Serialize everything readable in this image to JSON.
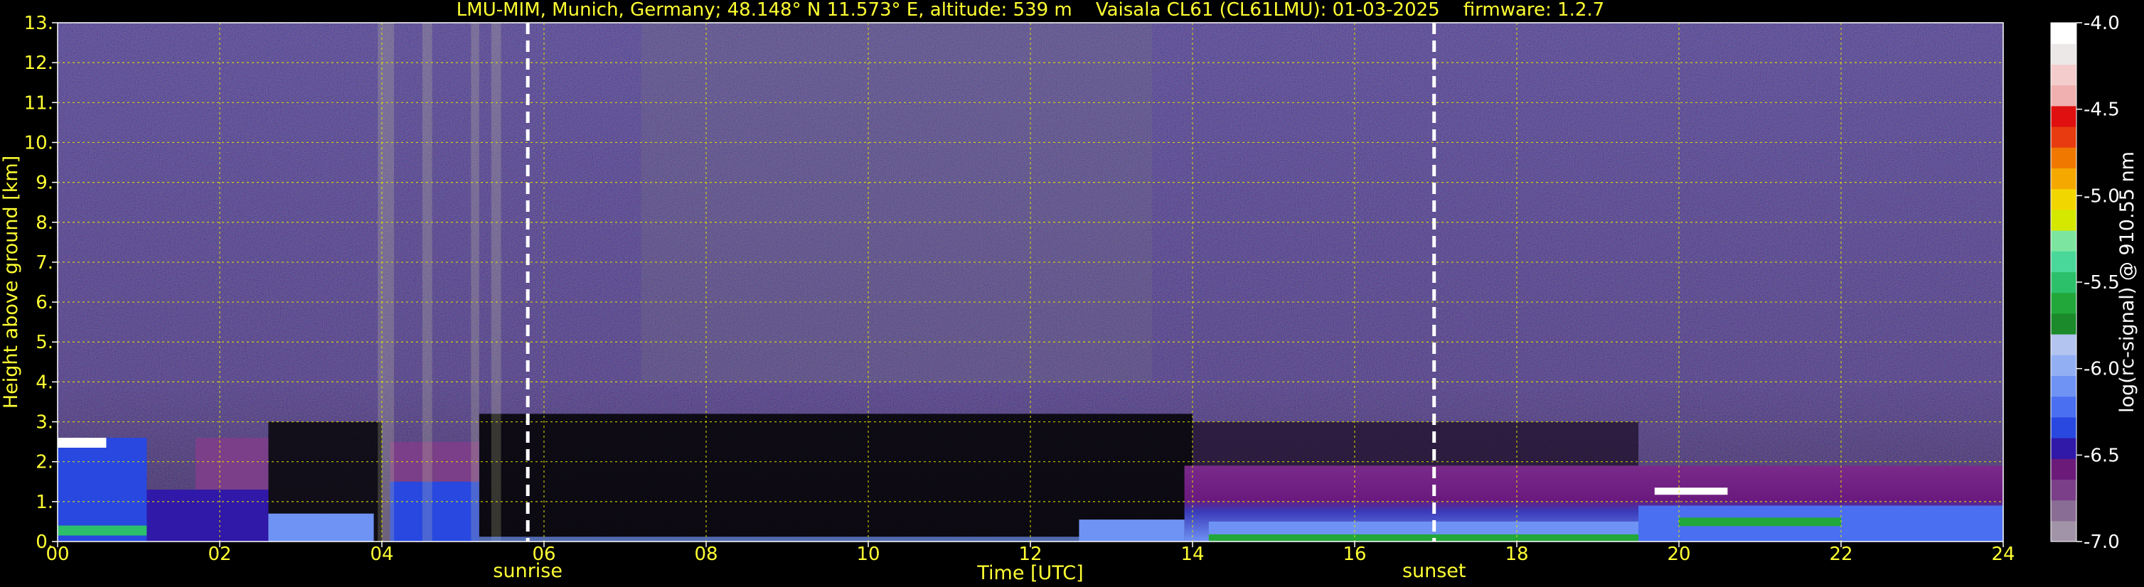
{
  "chart_data": {
    "type": "heatmap",
    "title": "LMU-MIM, Munich, Germany; 48.148° N 11.573° E, altitude: 539 m    Vaisala CL61 (CL61LMU): 01-03-2025    firmware: 1.2.7",
    "xlabel": "Time [UTC]",
    "ylabel": "Height above ground [km]",
    "colorbar_label": "log(rc-signal) @ 910.55 nm",
    "xlim": [
      0,
      24
    ],
    "ylim": [
      0,
      13
    ],
    "x_ticks": [
      0,
      2,
      4,
      6,
      8,
      10,
      12,
      14,
      16,
      18,
      20,
      22,
      24
    ],
    "x_tick_labels": [
      "00",
      "02",
      "04",
      "06",
      "08",
      "10",
      "12",
      "14",
      "16",
      "18",
      "20",
      "22",
      "24"
    ],
    "y_ticks": [
      0,
      1,
      2,
      3,
      4,
      5,
      6,
      7,
      8,
      9,
      10,
      11,
      12,
      13
    ],
    "y_tick_labels": [
      "0.",
      "1.",
      "2.",
      "3.",
      "4.",
      "5.",
      "6.",
      "7.",
      "8.",
      "9.",
      "10.",
      "11.",
      "12.",
      "13."
    ],
    "grid": true,
    "colorbar": {
      "range": [
        -7.0,
        -4.0
      ],
      "ticks": [
        -7.0,
        -6.5,
        -6.0,
        -5.5,
        -5.0,
        -4.5,
        -4.0
      ],
      "tick_labels": [
        "-7.0",
        "-6.5",
        "-6.0",
        "-5.5",
        "-5.0",
        "-4.5",
        "-4.0"
      ],
      "colors": [
        "#a294a8",
        "#8a6d95",
        "#7a3f88",
        "#6b1a7a",
        "#3018a8",
        "#2848e0",
        "#4a6ff0",
        "#6f93f4",
        "#93aff4",
        "#b4c4f0",
        "#1a8a2a",
        "#22a83a",
        "#2cc06a",
        "#4ad89a",
        "#7ce6a0",
        "#d4e800",
        "#f2d600",
        "#f5a800",
        "#f07800",
        "#e83c10",
        "#e01010",
        "#f0b0b0",
        "#f4cccc",
        "#ece8e8",
        "#ffffff"
      ]
    },
    "markers": [
      {
        "label": "sunrise",
        "time": 5.8
      },
      {
        "label": "sunset",
        "time": 16.98
      }
    ]
  }
}
